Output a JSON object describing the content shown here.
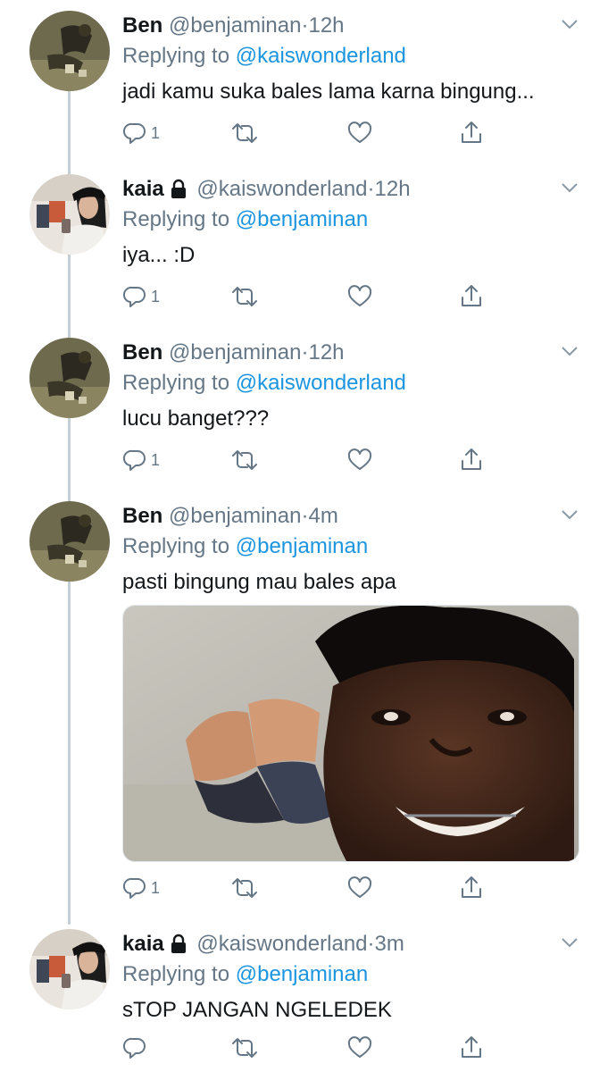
{
  "tweets": [
    {
      "name": "Ben",
      "locked": false,
      "handle": "@benjaminan",
      "time": "12h",
      "replying_prefix": "Replying to",
      "replying_to": "@kaiswonderland",
      "text": "jadi kamu suka bales lama karna bingung...",
      "reply_count": "1",
      "avatar": "ben-avatar"
    },
    {
      "name": "kaia",
      "locked": true,
      "handle": "@kaiswonderland",
      "time": "12h",
      "replying_prefix": "Replying to",
      "replying_to": "@benjaminan",
      "text": "iya... :D",
      "reply_count": "1",
      "avatar": "kaia-avatar"
    },
    {
      "name": "Ben",
      "locked": false,
      "handle": "@benjaminan",
      "time": "12h",
      "replying_prefix": "Replying to",
      "replying_to": "@kaiswonderland",
      "text": "lucu banget???",
      "reply_count": "1",
      "avatar": "ben-avatar"
    },
    {
      "name": "Ben",
      "locked": false,
      "handle": "@benjaminan",
      "time": "4m",
      "replying_prefix": "Replying to",
      "replying_to": "@benjaminan",
      "text": "pasti bingung mau bales apa",
      "reply_count": "1",
      "avatar": "ben-avatar",
      "has_media": true
    },
    {
      "name": "kaia",
      "locked": true,
      "handle": "@kaiswonderland",
      "time": "3m",
      "replying_prefix": "Replying to",
      "replying_to": "@benjaminan",
      "text": "sTOP JANGAN NGELEDEK",
      "reply_count": "",
      "avatar": "kaia-avatar"
    }
  ],
  "separator": "·",
  "icons": {
    "reply": "reply-icon",
    "retweet": "retweet-icon",
    "like": "heart-icon",
    "share": "share-icon",
    "more": "chevron-down-icon",
    "lock": "lock-icon"
  },
  "colors": {
    "text": "#14171a",
    "muted": "#657786",
    "link": "#1b95e0",
    "thread_line": "#c4cfd6"
  }
}
